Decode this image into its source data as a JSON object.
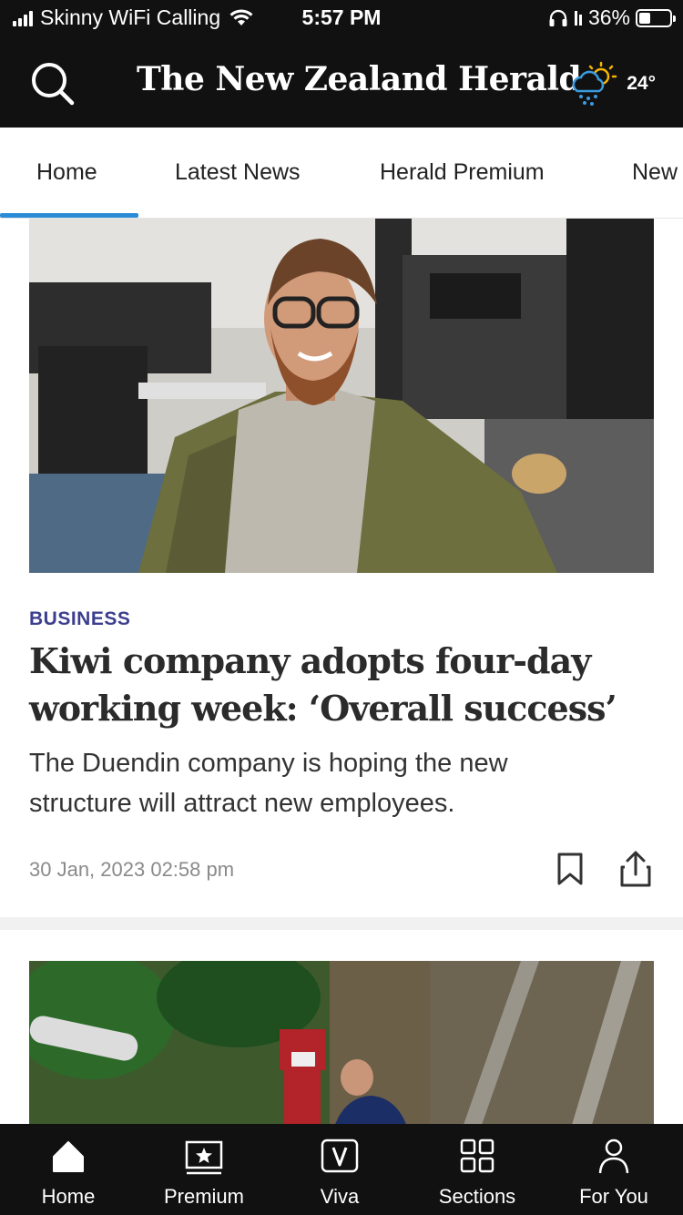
{
  "status_bar": {
    "carrier": "Skinny WiFi Calling",
    "time": "5:57 PM",
    "battery_percent": "36%",
    "battery_level": 0.36
  },
  "header": {
    "masthead": "The New Zealand Herald",
    "search_icon": "search-icon",
    "weather_icon": "sun-rain-cloud-icon",
    "temperature": "24°"
  },
  "nav": {
    "tabs": [
      {
        "label": "Home",
        "active": true
      },
      {
        "label": "Latest News",
        "active": false
      },
      {
        "label": "Herald Premium",
        "active": false
      },
      {
        "label": "New",
        "active": false
      }
    ],
    "active_color": "#2a8bd6"
  },
  "article": {
    "category": "BUSINESS",
    "headline": "Kiwi company adopts four-day working week: ‘Overall success’",
    "summary": "The Duendin company is hoping the new structure will attract new employees.",
    "timestamp": "30 Jan, 2023 02:58 pm",
    "bookmark_icon": "bookmark-icon",
    "share_icon": "share-icon"
  },
  "colors": {
    "category": "#3c3f8f",
    "header_bg": "#111111"
  },
  "bottom_nav": {
    "items": [
      {
        "label": "Home",
        "icon": "home-icon"
      },
      {
        "label": "Premium",
        "icon": "premium-star-icon"
      },
      {
        "label": "Viva",
        "icon": "viva-icon"
      },
      {
        "label": "Sections",
        "icon": "sections-grid-icon"
      },
      {
        "label": "For You",
        "icon": "person-icon"
      }
    ]
  }
}
